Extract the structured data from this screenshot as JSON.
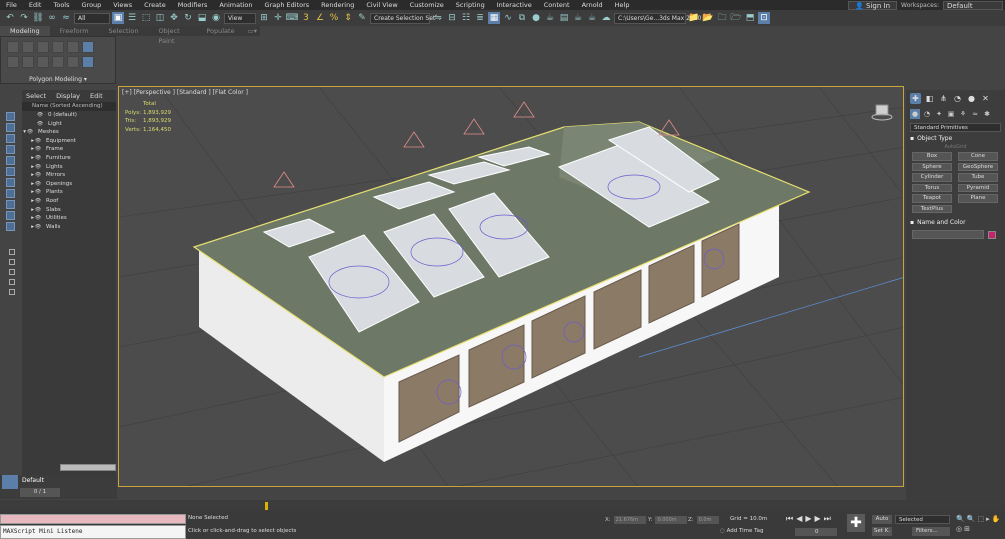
{
  "menu": [
    "File",
    "Edit",
    "Tools",
    "Group",
    "Views",
    "Create",
    "Modifiers",
    "Animation",
    "Graph Editors",
    "Rendering",
    "Civil View",
    "Customize",
    "Scripting",
    "Interactive",
    "Content",
    "Arnold",
    "Help"
  ],
  "signin": "Sign In",
  "workspaces_label": "Workspaces:",
  "workspaces_value": "Default",
  "toolbar": {
    "filter_value": "All",
    "refcoord_value": "View",
    "selection_set": "Create Selection Set",
    "path_value": "C:\\Users\\Ge...3ds Max 2020"
  },
  "ribbon": {
    "tabs": [
      "Modeling",
      "Freeform",
      "Selection",
      "Object Paint",
      "Populate"
    ],
    "active_tab": "Modeling",
    "panel_label": "Polygon Modeling ▾"
  },
  "explorer": {
    "tabs": [
      "Select",
      "Display",
      "Edit"
    ],
    "column_header": "Name (Sorted Ascending)",
    "rows": [
      {
        "label": "0 (default)",
        "indent": 14,
        "expander": ""
      },
      {
        "label": "Light",
        "indent": 14,
        "expander": ""
      },
      {
        "label": "Meshes",
        "indent": 4,
        "expander": "▾"
      },
      {
        "label": "Equipment",
        "indent": 12,
        "expander": "▸"
      },
      {
        "label": "Frame",
        "indent": 12,
        "expander": "▸"
      },
      {
        "label": "Furniture",
        "indent": 12,
        "expander": "▸"
      },
      {
        "label": "Lights",
        "indent": 12,
        "expander": "▸"
      },
      {
        "label": "Mirrors",
        "indent": 12,
        "expander": "▸"
      },
      {
        "label": "Openings",
        "indent": 12,
        "expander": "▸"
      },
      {
        "label": "Plants",
        "indent": 12,
        "expander": "▸"
      },
      {
        "label": "Roof",
        "indent": 12,
        "expander": "▸"
      },
      {
        "label": "Slabs",
        "indent": 12,
        "expander": "▸"
      },
      {
        "label": "Utilities",
        "indent": 12,
        "expander": "▸"
      },
      {
        "label": "Walls",
        "indent": 12,
        "expander": "▸"
      }
    ],
    "layer": "Default"
  },
  "viewport": {
    "label": "[+] [Perspective ] [Standard ] [Flat Color ]",
    "stats": {
      "total": "Total",
      "polys_label": "Polys:",
      "polys": "1,893,929",
      "tris_label": "Tris:",
      "tris": "1,893,929",
      "verts_label": "Verts:",
      "verts": "1,164,450"
    }
  },
  "command_panel": {
    "dropdown": "Standard Primitives",
    "rollout_object_type": "Object Type",
    "autogrid": "AutoGrid",
    "primitives": [
      "Box",
      "Cone",
      "Sphere",
      "GeoSphere",
      "Cylinder",
      "Tube",
      "Torus",
      "Pyramid",
      "Teapot",
      "Plane",
      "TextPlus"
    ],
    "rollout_name_color": "Name and Color",
    "swatch_color": "#c8226e"
  },
  "timeline": {
    "frame": "0 / 1"
  },
  "status": {
    "maxscript": "MAXScript Mini Listene",
    "none_selected": "None Selected",
    "prompt": "Click or click-and-drag to select objects",
    "x_label": "X:",
    "x_value": "21.676m",
    "y_label": "Y:",
    "y_value": "0.000m",
    "z_label": "Z:",
    "z_value": "0.0m",
    "grid": "Grid = 10.0m",
    "add_time_tag": "Add Time Tag",
    "frame_value": "0",
    "auto": "Auto",
    "setk": "Set K.",
    "selected": "Selected",
    "filters": "Filters..."
  }
}
